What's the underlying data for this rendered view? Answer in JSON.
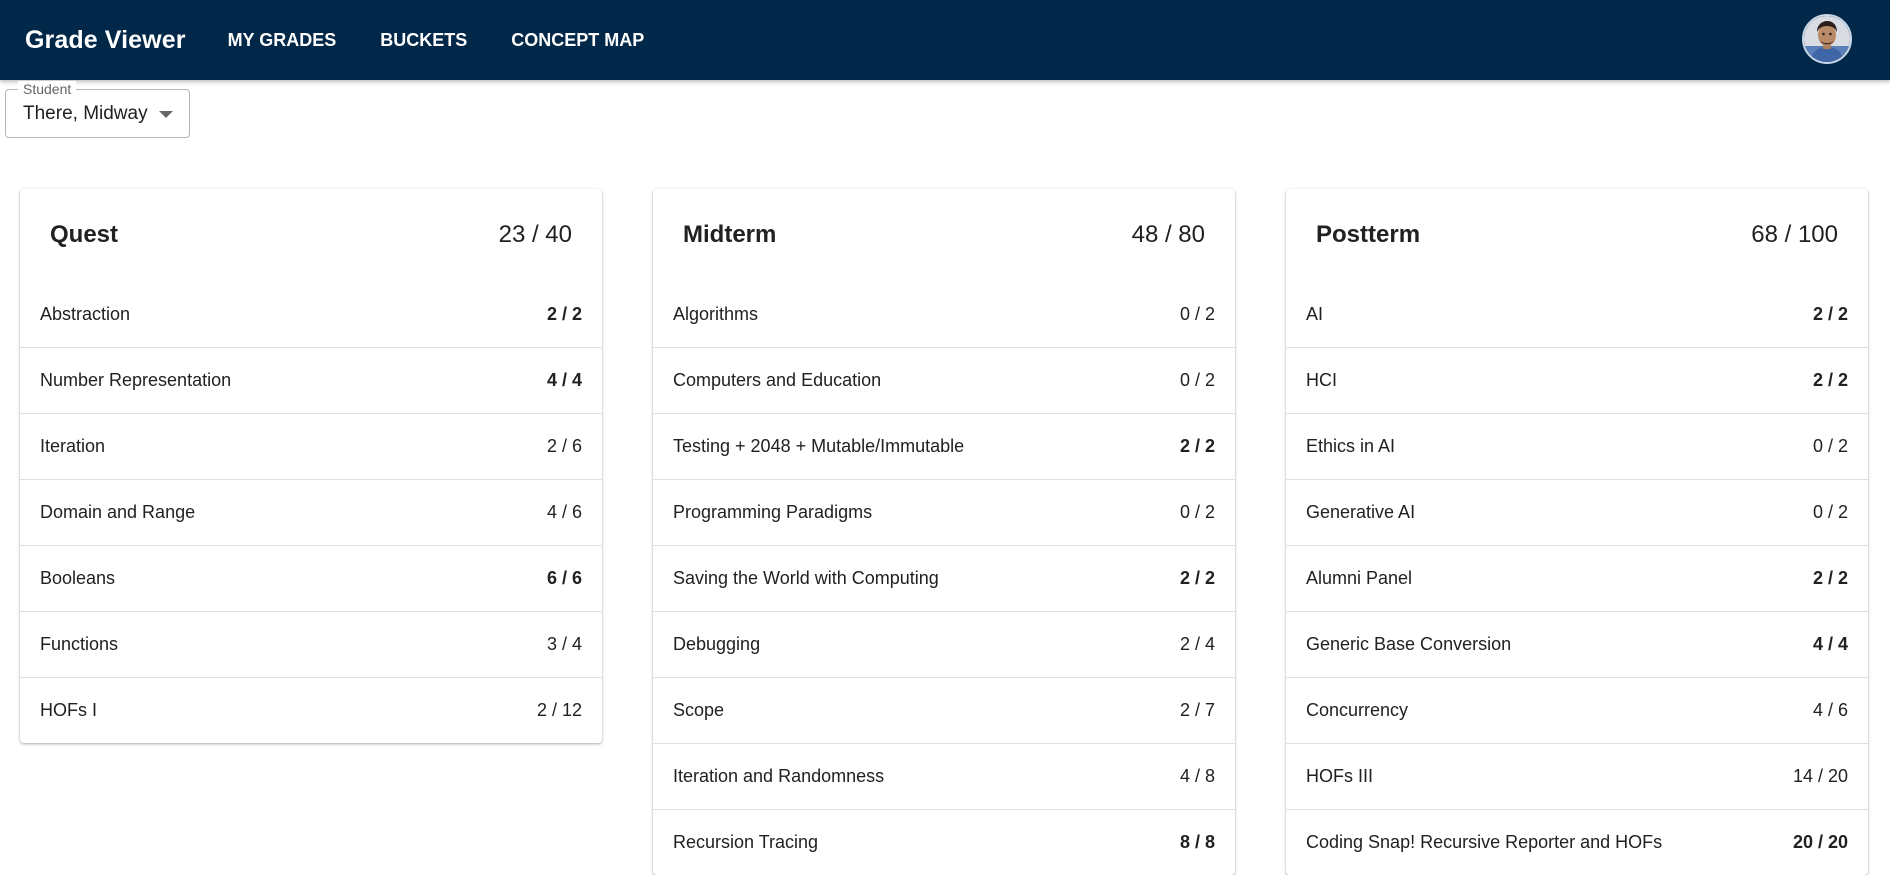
{
  "app": {
    "title": "Grade Viewer"
  },
  "nav": [
    {
      "label": "MY GRADES"
    },
    {
      "label": "BUCKETS"
    },
    {
      "label": "CONCEPT MAP"
    }
  ],
  "student_select": {
    "legend": "Student",
    "value": "There, Midway"
  },
  "cards": [
    {
      "title": "Quest",
      "score": "23 / 40",
      "rows": [
        {
          "label": "Abstraction",
          "score": "2 / 2",
          "full": true
        },
        {
          "label": "Number Representation",
          "score": "4 / 4",
          "full": true
        },
        {
          "label": "Iteration",
          "score": "2 / 6",
          "full": false
        },
        {
          "label": "Domain and Range",
          "score": "4 / 6",
          "full": false
        },
        {
          "label": "Booleans",
          "score": "6 / 6",
          "full": true
        },
        {
          "label": "Functions",
          "score": "3 / 4",
          "full": false
        },
        {
          "label": "HOFs I",
          "score": "2 / 12",
          "full": false
        }
      ]
    },
    {
      "title": "Midterm",
      "score": "48 / 80",
      "rows": [
        {
          "label": "Algorithms",
          "score": "0 / 2",
          "full": false
        },
        {
          "label": "Computers and Education",
          "score": "0 / 2",
          "full": false
        },
        {
          "label": "Testing + 2048 + Mutable/Immutable",
          "score": "2 / 2",
          "full": true
        },
        {
          "label": "Programming Paradigms",
          "score": "0 / 2",
          "full": false
        },
        {
          "label": "Saving the World with Computing",
          "score": "2 / 2",
          "full": true
        },
        {
          "label": "Debugging",
          "score": "2 / 4",
          "full": false
        },
        {
          "label": "Scope",
          "score": "2 / 7",
          "full": false
        },
        {
          "label": "Iteration and Randomness",
          "score": "4 / 8",
          "full": false
        },
        {
          "label": "Recursion Tracing",
          "score": "8 / 8",
          "full": true
        }
      ]
    },
    {
      "title": "Postterm",
      "score": "68 / 100",
      "rows": [
        {
          "label": "AI",
          "score": "2 / 2",
          "full": true
        },
        {
          "label": "HCI",
          "score": "2 / 2",
          "full": true
        },
        {
          "label": "Ethics in AI",
          "score": "0 / 2",
          "full": false
        },
        {
          "label": "Generative AI",
          "score": "0 / 2",
          "full": false
        },
        {
          "label": "Alumni Panel",
          "score": "2 / 2",
          "full": true
        },
        {
          "label": "Generic Base Conversion",
          "score": "4 / 4",
          "full": true
        },
        {
          "label": "Concurrency",
          "score": "4 / 6",
          "full": false
        },
        {
          "label": "HOFs III",
          "score": "14 / 20",
          "full": false
        },
        {
          "label": "Coding Snap! Recursive Reporter and HOFs",
          "score": "20 / 20",
          "full": true
        }
      ]
    }
  ],
  "colors": {
    "appbar": "#012749",
    "text": "#212121"
  }
}
